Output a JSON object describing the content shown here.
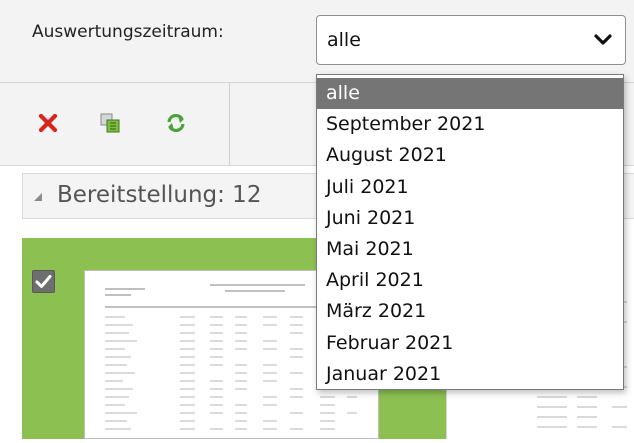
{
  "filter": {
    "label": "Auswertungszeitraum:",
    "selected_value": "alle"
  },
  "dropdown": {
    "options": [
      "alle",
      "September 2021",
      "August 2021",
      "Juli 2021",
      "Juni 2021",
      "Mai 2021",
      "April 2021",
      "März 2021",
      "Februar 2021",
      "Januar 2021"
    ],
    "selected_index": 0
  },
  "toolbar": {
    "icons": [
      "delete-icon",
      "copy-icon",
      "refresh-icon"
    ]
  },
  "section": {
    "title": "Bereitstellung:  12"
  },
  "colors": {
    "accent_green": "#8cc152",
    "delete_red": "#d9231f",
    "selected_option_bg": "#757575"
  }
}
